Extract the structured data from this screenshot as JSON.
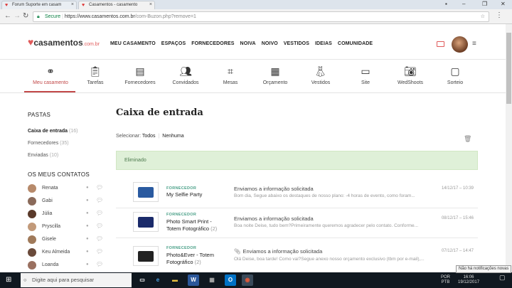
{
  "browser": {
    "tabs": [
      {
        "title": "Forum Suporte em casam"
      },
      {
        "title": "Casamentos - casamento"
      }
    ],
    "url_secure_label": "Secure",
    "url_host": "https://www.casamentos.com.br",
    "url_path": "/com-Buzon.php?remove=1"
  },
  "site": {
    "logo_text": "casamentos",
    "logo_suffix": ".com.br",
    "nav": [
      "MEU CASAMENTO",
      "ESPAÇOS",
      "FORNECEDORES",
      "NOIVA",
      "NOIVO",
      "VESTIDOS",
      "IDEIAS",
      "COMUNIDADE"
    ]
  },
  "tools": [
    {
      "label": "Meu casamento",
      "icon": "rings-icon"
    },
    {
      "label": "Tarefas",
      "icon": "clipboard-icon"
    },
    {
      "label": "Fornecedores",
      "icon": "notebook-icon"
    },
    {
      "label": "Convidados",
      "icon": "guests-icon"
    },
    {
      "label": "Mesas",
      "icon": "tables-icon"
    },
    {
      "label": "Orçamento",
      "icon": "calculator-icon"
    },
    {
      "label": "Vestidos",
      "icon": "dress-icon"
    },
    {
      "label": "Site",
      "icon": "website-icon"
    },
    {
      "label": "WedShoots",
      "icon": "camera-icon"
    },
    {
      "label": "Sorteio",
      "icon": "raffle-icon"
    }
  ],
  "sidebar": {
    "folders_heading": "PASTAS",
    "folders": [
      {
        "label": "Caixa de entrada",
        "count": "(16)"
      },
      {
        "label": "Fornecedores",
        "count": "(35)"
      },
      {
        "label": "Enviadas",
        "count": "(10)"
      }
    ],
    "contacts_heading": "OS MEUS CONTATOS",
    "contacts": [
      "Renata",
      "Gabi",
      "Júlia",
      "Pryscilla",
      "Gisele",
      "Keu Almeida",
      "Loanda"
    ]
  },
  "main": {
    "title": "Caixa de entrada",
    "select_label": "Selecionar:",
    "select_all": "Todos",
    "select_none": "Nenhuma",
    "alert": "Eliminado",
    "messages": [
      {
        "tag": "FORNECEDOR",
        "vendor": "My Selfie Party",
        "vendor_count": "",
        "subject": "Enviamos a informação solicitada",
        "preview": "Bom dia, Segue abaixo os destaques de nosso plano: -4 horas de evento, como foram...",
        "date": "14/12/17 – 10:39",
        "attachment": false
      },
      {
        "tag": "FORNECEDOR",
        "vendor": "Photo Smart Print - Totem Fotográfico",
        "vendor_count": "(2)",
        "subject": "Enviamos a informação solicitada",
        "preview": "Boa noite Deise, tudo bem?Primeiramente queremos agradecer pelo contato. Conforme...",
        "date": "08/12/17 – 15:46",
        "attachment": false
      },
      {
        "tag": "FORNECEDOR",
        "vendor": "Photo&Ever - Totem Fotográfico",
        "vendor_count": "(2)",
        "subject": "Enviamos a informação solicitada",
        "preview": "Olá Deise, boa tarde! Como vai?Segue anexo nosso orçamento exclusivo (tbm por e-mail),...",
        "date": "07/12/17 – 14:47",
        "attachment": true
      }
    ]
  },
  "taskbar": {
    "search_placeholder": "Digite aqui para pesquisar",
    "lang": "POR",
    "lang2": "PTB",
    "time": "16:06",
    "date": "19/12/2017",
    "tooltip": "Não há notificações novas"
  },
  "colors": {
    "brand": "#e05a5a",
    "active_tab": "#c24848",
    "alert_bg": "#dff0d8",
    "tag_green": "#4aa088"
  }
}
